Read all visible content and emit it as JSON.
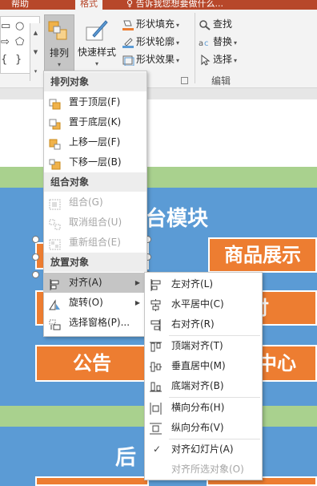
{
  "ribbon": {
    "tabs": [
      {
        "label": "帮助"
      },
      {
        "label": "格式"
      },
      {
        "label": "告诉我您想要做什么..."
      }
    ],
    "arrange_label": "排列",
    "quick_styles_label": "快速样式",
    "shape_fill_label": "形状填充",
    "shape_outline_label": "形状轮廓",
    "shape_effects_label": "形状效果",
    "find_label": "查找",
    "replace_label": "替换",
    "select_label": "选择",
    "editing_group_label": "编辑"
  },
  "menu": {
    "arrange_header": "排列对象",
    "bring_front": "置于顶层(F)",
    "send_back": "置于底层(K)",
    "bring_forward": "上移一层(F)",
    "send_backward": "下移一层(B)",
    "group_header": "组合对象",
    "group": "组合(G)",
    "ungroup": "取消组合(U)",
    "regroup": "重新组合(E)",
    "position_header": "放置对象",
    "align": "对齐(A)",
    "rotate": "旋转(O)",
    "selection_pane": "选择窗格(P)..."
  },
  "submenu": {
    "align_left": "左对齐(L)",
    "align_center": "水平居中(C)",
    "align_right": "右对齐(R)",
    "align_top": "顶端对齐(T)",
    "align_middle": "垂直居中(M)",
    "align_bottom": "底端对齐(B)",
    "distribute_h": "横向分布(H)",
    "distribute_v": "纵向分布(V)",
    "align_to_slide": "对齐幻灯片(A)",
    "align_selected": "对齐所选对象(O)"
  },
  "slide": {
    "heading_top": "台模块",
    "box_product": "商品展示",
    "box_pay": "付",
    "box_notice": "公告",
    "box_center": "中心",
    "heading_bottom": "后"
  },
  "colors": {
    "accent_tab": "#b7472a",
    "orange": "#ed7d31",
    "blue": "#5b9bd5",
    "green": "#a9d18e"
  }
}
